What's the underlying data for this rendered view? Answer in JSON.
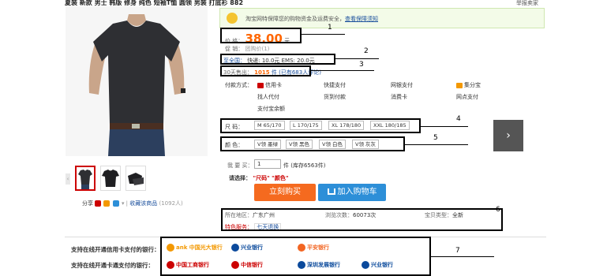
{
  "header": {
    "title": "夏装 新款 男士 韩版 修身 纯色 短袖T恤 圆领 男装 打底衫 882",
    "right": "举报卖家"
  },
  "notice": {
    "text": "淘宝网特保障您的购物资金及运费安全，",
    "link": "查看保障须知"
  },
  "price": {
    "label": "价    格：",
    "value": "38.00",
    "unit": "元"
  },
  "promo": {
    "label": "促    销：",
    "value": "团购价(1)"
  },
  "shipping": {
    "label": "至全国：",
    "text": "快递: 10.0元   EMS: 20.0元"
  },
  "sales": {
    "label": "30天售出：",
    "count": "1015",
    "rest": "件 (已有683人评论)"
  },
  "payment": {
    "label": "付款方式：",
    "methods": [
      "信用卡",
      "快捷支付",
      "网银支付",
      "集分宝",
      "找人代付",
      "货到付款",
      "消费卡",
      "网点支付",
      "支付宝余额"
    ]
  },
  "size": {
    "label": "尺    码：",
    "options": [
      "M 65/170",
      "L 170/175",
      "XL 178/180",
      "XXL 180/185"
    ]
  },
  "color": {
    "label": "颜    色：",
    "options": [
      "V领 墨绿",
      "V领 黑色",
      "V领 白色",
      "V领 灰灰"
    ]
  },
  "quantity": {
    "label": "我 要 买：",
    "value": "1",
    "stock": "件 (库存6563件)"
  },
  "select_prompt": {
    "label": "请选择：",
    "value": "\"尺码\" \"颜色\""
  },
  "buttons": {
    "buy": "立刻购买",
    "cart": "加入购物车"
  },
  "share": {
    "label": "分享",
    "collect": "收藏该商品",
    "count": "(1092人)"
  },
  "details": {
    "region_label": "所在地区：",
    "region": "广东广州",
    "views_label": "浏览次数：",
    "views": "60073次",
    "type_label": "宝贝类型：",
    "type": "全新",
    "service_label": "特色服务：",
    "service": "七天退换"
  },
  "banks": {
    "credit_label": "支持在线开通信用卡支付的银行：",
    "card_label": "支持在线开通卡通支付的银行：",
    "credit": [
      {
        "name": "ank 中国光大银行",
        "color": "#f39800"
      },
      {
        "name": "兴业银行",
        "color": "#0b4a9c"
      },
      {
        "name": "平安银行",
        "color": "#f26522"
      }
    ],
    "card": [
      {
        "name": "中国工商银行",
        "color": "#c00"
      },
      {
        "name": "中信银行",
        "color": "#c00"
      },
      {
        "name": "深圳发展银行",
        "color": "#0b4a9c"
      },
      {
        "name": "兴业银行",
        "color": "#0b4a9c"
      }
    ]
  },
  "annotations": [
    "1",
    "2",
    "3",
    "4",
    "5",
    "6",
    "7"
  ],
  "pager": {
    "symbol": "›"
  },
  "colors": {
    "accent": "#f60",
    "buy": "#f56a1f",
    "cart": "#2d8fd8"
  }
}
